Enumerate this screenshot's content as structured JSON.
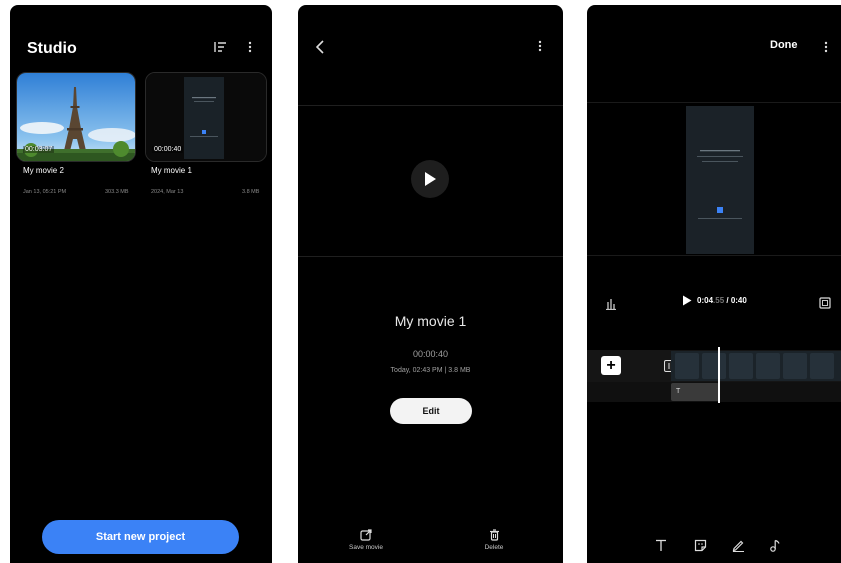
{
  "screen1": {
    "title": "Studio",
    "projects": [
      {
        "name": "My movie 2",
        "duration": "00:03:07",
        "date": "Jan 13, 05:21 PM",
        "size": "303.3 MB"
      },
      {
        "name": "My movie 1",
        "duration": "00:00:40",
        "date": "2024, Mar 13",
        "size": "3.8 MB"
      }
    ],
    "start_button": "Start new project"
  },
  "screen2": {
    "movie_title": "My movie 1",
    "duration": "00:00:40",
    "meta": "Today, 02:43 PM | 3.8 MB",
    "edit_label": "Edit",
    "save_label": "Save movie",
    "delete_label": "Delete"
  },
  "screen3": {
    "done_label": "Done",
    "current_time": "0:04",
    "current_frac": ".55",
    "total_time": "/ 0:40",
    "text_clip_label": "T"
  },
  "colors": {
    "accent_blue": "#3b82f6",
    "background": "#000000"
  }
}
